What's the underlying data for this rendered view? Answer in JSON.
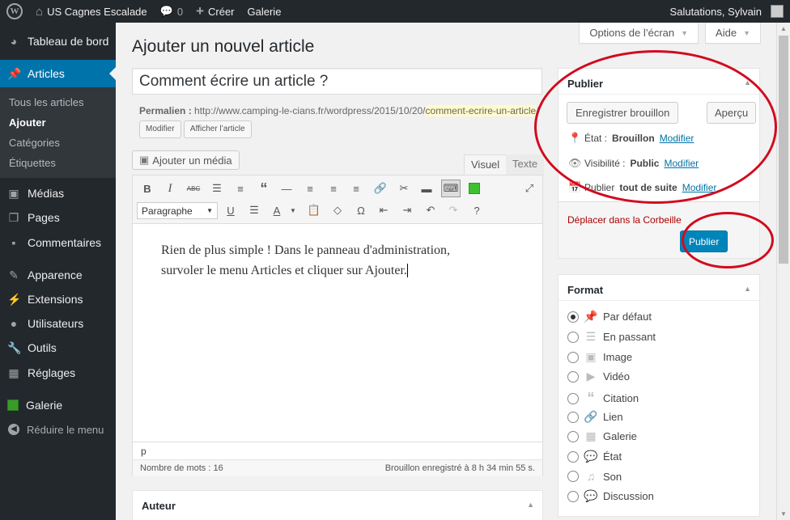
{
  "adminbar": {
    "site_name": "US Cagnes Escalade",
    "comments_count": "0",
    "new_label": "Créer",
    "gallery_label": "Galerie",
    "greeting": "Salutations, Sylvain"
  },
  "menu": {
    "dashboard": "Tableau de bord",
    "articles": "Articles",
    "sub": [
      "Tous les articles",
      "Ajouter",
      "Catégories",
      "Étiquettes"
    ],
    "media": "Médias",
    "pages": "Pages",
    "comments": "Commentaires",
    "appearance": "Apparence",
    "extensions": "Extensions",
    "users": "Utilisateurs",
    "tools": "Outils",
    "settings": "Réglages",
    "gallery": "Galerie",
    "collapse": "Réduire le menu"
  },
  "screen_meta": {
    "options": "Options de l’écran",
    "help": "Aide"
  },
  "page": {
    "heading": "Ajouter un nouvel article",
    "title_value": "Comment écrire un article ?",
    "permalink_label": "Permalien :",
    "permalink_base": "http://www.camping-le-cians.fr/wordpress/2015/10/20/",
    "permalink_slug_1": "comment-ecrire-",
    "permalink_slug_2": "un-article",
    "permalink_end": "/",
    "edit_button": "Modifier",
    "view_button": "Afficher l’article"
  },
  "editor": {
    "add_media": "Ajouter un média",
    "tab_visual": "Visuel",
    "tab_text": "Texte",
    "format_select": "Paragraphe",
    "content_line_1": "Rien de plus simple ! Dans le panneau d'administration,",
    "content_line_2": "survoler le menu Articles et cliquer sur Ajouter.",
    "path": "p",
    "word_count": "Nombre de mots : 16",
    "draft_saved": "Brouillon enregistré à 8 h 34 min 55 s."
  },
  "author_box": {
    "title": "Auteur"
  },
  "publish": {
    "title": "Publier",
    "save_draft": "Enregistrer brouillon",
    "preview": "Aperçu",
    "status_label": "État :",
    "status_value": "Brouillon",
    "visibility_label": "Visibilité :",
    "visibility_value": "Public",
    "schedule_label": "Publier",
    "schedule_value": "tout de suite",
    "modify": "Modifier",
    "trash": "Déplacer dans la Corbeille",
    "publish_button": "Publier"
  },
  "format": {
    "title": "Format",
    "options": [
      "Par défaut",
      "En passant",
      "Image",
      "Vidéo",
      "Citation",
      "Lien",
      "Galerie",
      "État",
      "Son",
      "Discussion"
    ],
    "selected": "Par défaut"
  },
  "colors": {
    "accent": "#0073aa",
    "publish_button": "#0085ba",
    "annotation": "#d10b1f"
  }
}
